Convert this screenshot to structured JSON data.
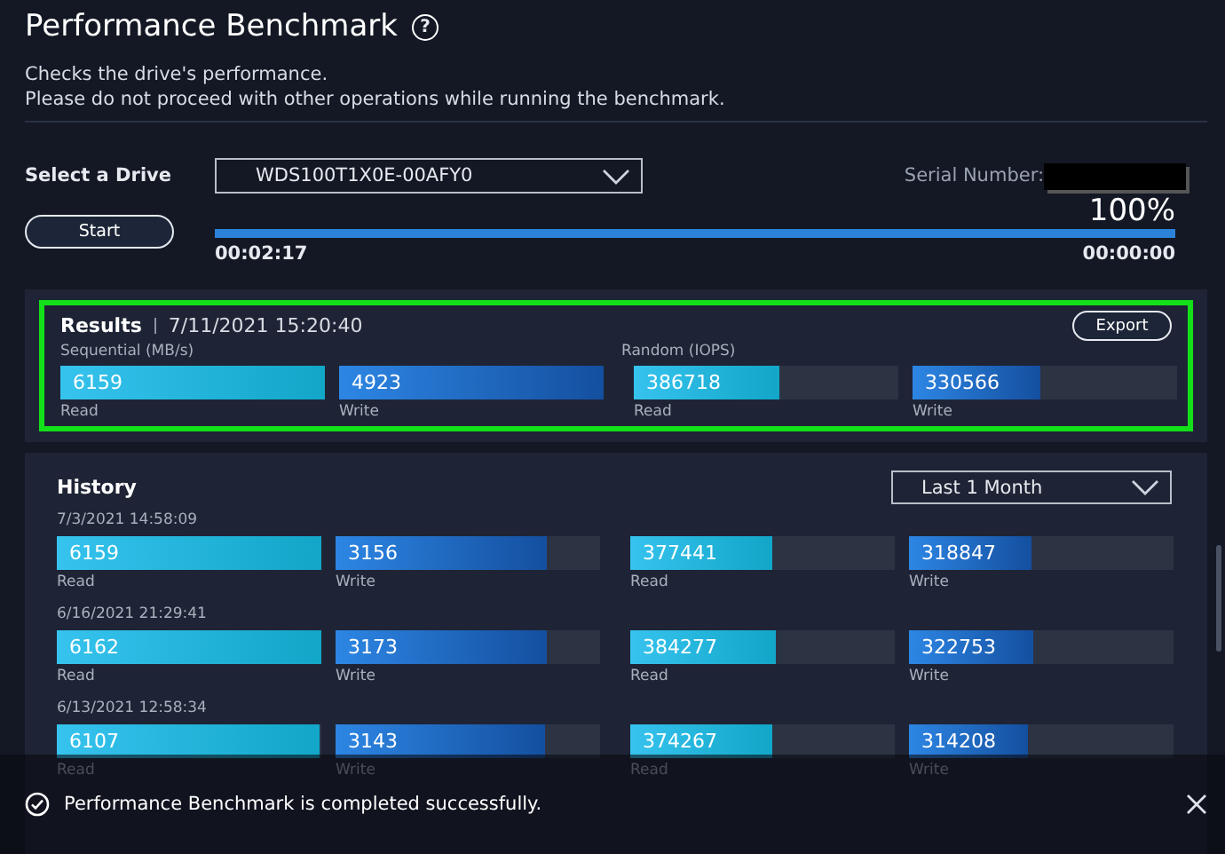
{
  "title": "Performance Benchmark",
  "help_icon": "?",
  "description": [
    "Checks the drive's performance.",
    "Please do not proceed with other operations while running the benchmark."
  ],
  "drive": {
    "label": "Select a Drive",
    "value": "WDS100T1X0E-00AFY0"
  },
  "serial": {
    "label": "Serial Number:",
    "redacted": true
  },
  "start_button": "Start",
  "progress": {
    "percent": "100%",
    "level": 1,
    "elapsed": "00:02:17",
    "remaining": "00:00:00"
  },
  "results": {
    "title": "Results",
    "timestamp": "7/11/2021 15:20:40",
    "highlighted": true,
    "export_button": "Export",
    "groups": [
      "Sequential (MB/s)",
      "Random (IOPS)"
    ],
    "bars": [
      {
        "value": "6159",
        "label": "Read",
        "kind": "read",
        "level": 1
      },
      {
        "value": "4923",
        "label": "Write",
        "kind": "write",
        "level": 1
      },
      {
        "value": "386718",
        "label": "Read",
        "kind": "read",
        "level": 0.55
      },
      {
        "value": "330566",
        "label": "Write",
        "kind": "write",
        "level": 0.48
      }
    ]
  },
  "history": {
    "title": "History",
    "filter": "Last 1 Month",
    "entries": [
      {
        "timestamp": "7/3/2021 14:58:09",
        "bars": [
          {
            "value": "6159",
            "label": "Read",
            "kind": "read",
            "level": 1
          },
          {
            "value": "3156",
            "label": "Write",
            "kind": "write",
            "level": 0.8
          },
          {
            "value": "377441",
            "label": "Read",
            "kind": "read",
            "level": 0.54
          },
          {
            "value": "318847",
            "label": "Write",
            "kind": "write",
            "level": 0.46
          }
        ]
      },
      {
        "timestamp": "6/16/2021 21:29:41",
        "bars": [
          {
            "value": "6162",
            "label": "Read",
            "kind": "read",
            "level": 1
          },
          {
            "value": "3173",
            "label": "Write",
            "kind": "write",
            "level": 0.8
          },
          {
            "value": "384277",
            "label": "Read",
            "kind": "read",
            "level": 0.55
          },
          {
            "value": "322753",
            "label": "Write",
            "kind": "write",
            "level": 0.47
          }
        ]
      },
      {
        "timestamp": "6/13/2021 12:58:34",
        "bars": [
          {
            "value": "6107",
            "label": "Read",
            "kind": "read",
            "level": 0.99
          },
          {
            "value": "3143",
            "label": "Write",
            "kind": "write",
            "level": 0.79
          },
          {
            "value": "374267",
            "label": "Read",
            "kind": "read",
            "level": 0.54
          },
          {
            "value": "314208",
            "label": "Write",
            "kind": "write",
            "level": 0.45
          }
        ]
      }
    ]
  },
  "toast": {
    "message": "Performance Benchmark is completed successfully."
  }
}
